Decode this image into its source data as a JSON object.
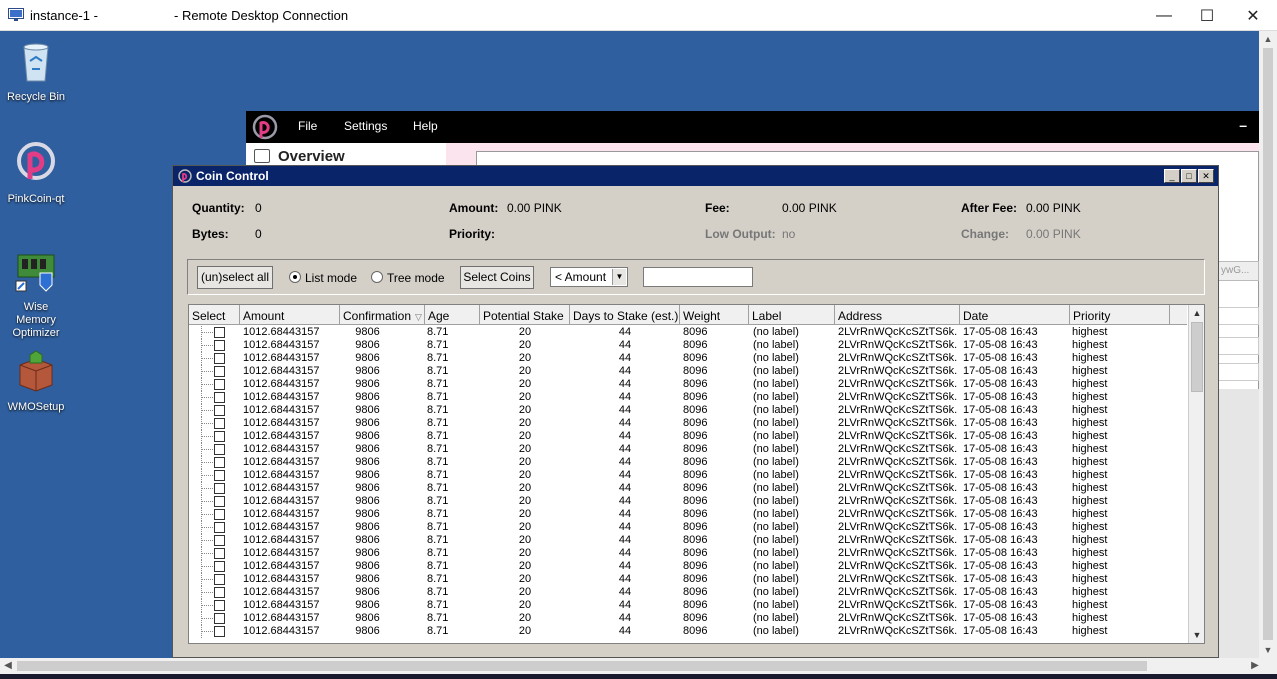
{
  "rdp": {
    "title_left": "instance-1 -",
    "title_right": "- Remote Desktop Connection",
    "minimize": "—",
    "maximize": "☐",
    "close": "✕"
  },
  "desktop_icons": [
    {
      "label": "Recycle Bin",
      "icon": "recycle-bin-icon"
    },
    {
      "label": "PinkCoin-qt",
      "icon": "pinkcoin-icon"
    },
    {
      "label": "Wise Memory Optimizer",
      "icon": "memory-optimizer-icon"
    },
    {
      "label": "WMOSetup",
      "icon": "installer-box-icon"
    }
  ],
  "pinkcoin": {
    "menu": [
      "File",
      "Settings",
      "Help"
    ],
    "nav_overview": "Overview",
    "side_text": "ywG..."
  },
  "coin_control": {
    "title": "Coin Control",
    "summary": {
      "quantity_label": "Quantity:",
      "quantity_value": "0",
      "bytes_label": "Bytes:",
      "bytes_value": "0",
      "amount_label": "Amount:",
      "amount_value": "0.00 PINK",
      "priority_label": "Priority:",
      "priority_value": "",
      "fee_label": "Fee:",
      "fee_value": "0.00 PINK",
      "low_output_label": "Low Output:",
      "low_output_value": "no",
      "after_fee_label": "After Fee:",
      "after_fee_value": "0.00 PINK",
      "change_label": "Change:",
      "change_value": "0.00 PINK"
    },
    "toolbar": {
      "unselect_all": "(un)select all",
      "list_mode": "List mode",
      "tree_mode": "Tree mode",
      "select_coins": "Select Coins",
      "filter_value": "< Amount",
      "filter_input_value": ""
    },
    "columns": [
      "Select",
      "Amount",
      "Confirmation",
      "Age",
      "Potential Stake",
      "Days to Stake (est.)",
      "Weight",
      "Label",
      "Address",
      "Date",
      "Priority"
    ],
    "row_template": {
      "amount": "1012.68443157",
      "confirmations": "9806",
      "age": "8.71",
      "potential_stake": "20",
      "days_to_stake": "44",
      "weight": "8096",
      "label": "(no label)",
      "address": "2LVrRnWQcKcSZtTS6k...",
      "date": "17-05-08 16:43",
      "priority": "highest"
    },
    "row_count": 24
  }
}
